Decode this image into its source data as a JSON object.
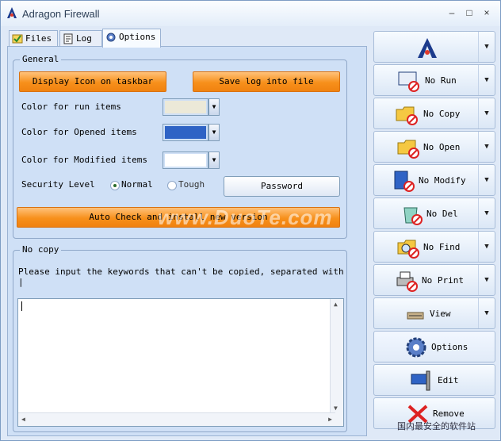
{
  "window": {
    "title": "Adragon Firewall",
    "controls": [
      "–",
      "□",
      "×"
    ]
  },
  "tabs": [
    {
      "label": "Files",
      "icon": "files-icon"
    },
    {
      "label": "Log",
      "icon": "log-icon"
    },
    {
      "label": "Options",
      "icon": "options-icon",
      "active": true
    }
  ],
  "general": {
    "legend": "General",
    "display_icon_btn": "Display Icon on taskbar",
    "save_log_btn": "Save log into file",
    "run_color_label": "Color for run items",
    "opened_color_label": "Color for Opened items",
    "modified_color_label": "Color for Modified items",
    "run_color": "#ece9d8",
    "opened_color": "#2f63c5",
    "modified_color": "#ffffff",
    "security_label": "Security Level",
    "normal_label": "Normal",
    "tough_label": "Tough",
    "password_btn": "Password",
    "auto_check_btn": "Auto Check and install new version"
  },
  "nocopy": {
    "legend": "No copy",
    "instruction": "Please input the keywords that can't be copied, separated with |",
    "value": ""
  },
  "sidebar": [
    {
      "label": "",
      "icon": "adragon-logo-icon",
      "dropdown": true
    },
    {
      "label": "No Run",
      "icon": "no-run-icon",
      "dropdown": true
    },
    {
      "label": "No Copy",
      "icon": "no-copy-icon",
      "dropdown": true
    },
    {
      "label": "No Open",
      "icon": "no-open-icon",
      "dropdown": true
    },
    {
      "label": "No Modify",
      "icon": "no-modify-icon",
      "dropdown": true
    },
    {
      "label": "No Del",
      "icon": "no-del-icon",
      "dropdown": true
    },
    {
      "label": "No Find",
      "icon": "no-find-icon",
      "dropdown": true
    },
    {
      "label": "No Print",
      "icon": "no-print-icon",
      "dropdown": true
    },
    {
      "label": "View",
      "icon": "view-icon",
      "dropdown": true
    },
    {
      "label": "Options",
      "icon": "gear-icon",
      "dropdown": false
    },
    {
      "label": "Edit",
      "icon": "edit-icon",
      "dropdown": false
    },
    {
      "label": "Remove",
      "icon": "remove-icon",
      "dropdown": false
    }
  ],
  "watermark": {
    "text": "www.DuoTe.com",
    "corner": "国内最安全的软件站"
  },
  "colors": {
    "accent_orange": "#f7901b",
    "window_bg": "#dfe9f7",
    "panel_bg": "#cfe0f6"
  }
}
